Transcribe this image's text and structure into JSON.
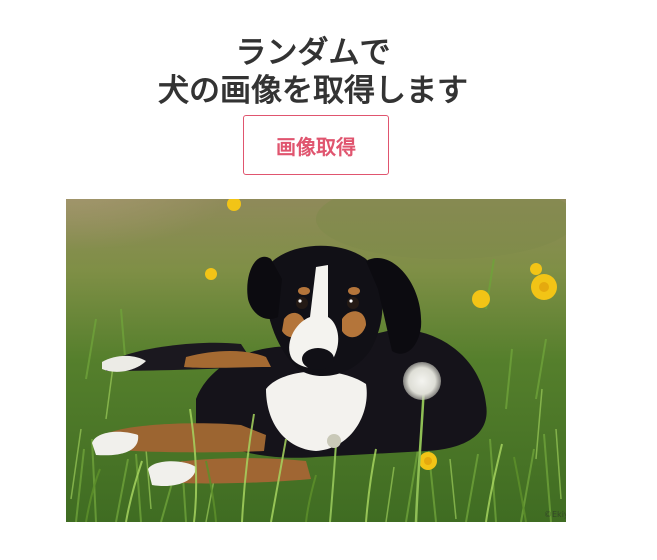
{
  "header": {
    "title_line1": "ランダムで",
    "title_line2": "犬の画像を取得します"
  },
  "actions": {
    "fetch_label": "画像取得"
  },
  "image": {
    "subject": "puppy-lying-in-grass-with-dandelions",
    "watermark": "©Ekiya"
  },
  "colors": {
    "accent": "#e0556f",
    "title_text": "#333333",
    "background": "#ffffff"
  }
}
